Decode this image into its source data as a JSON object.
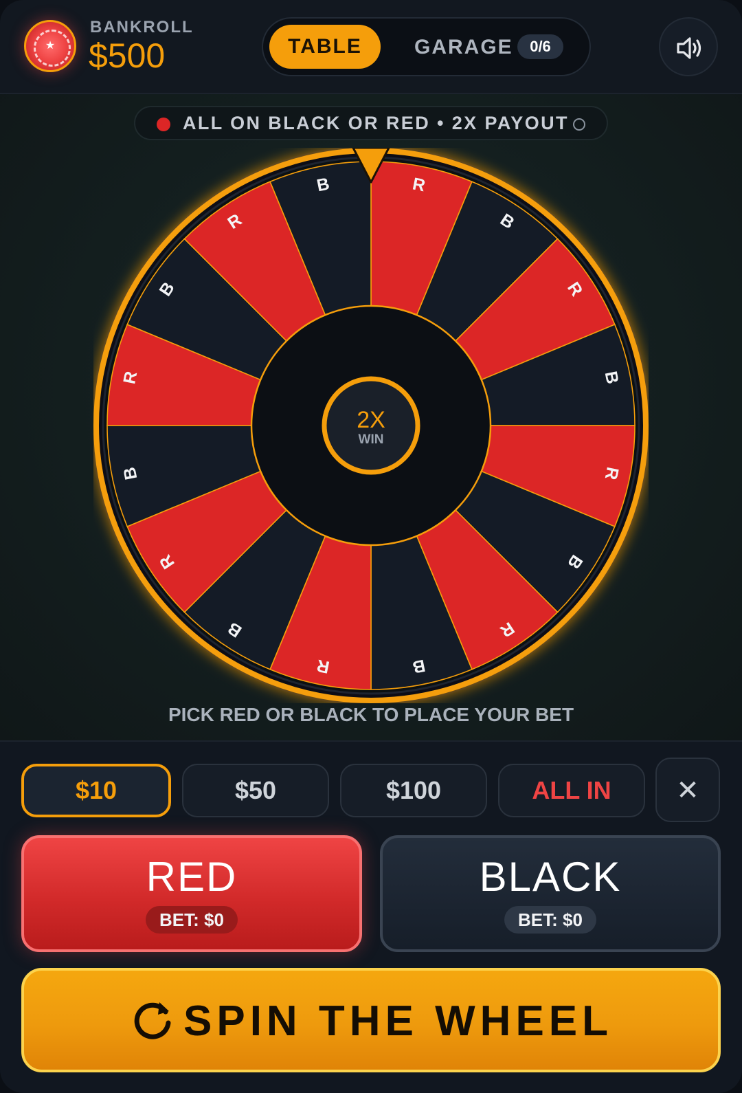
{
  "header": {
    "bankroll_label": "BANKROLL",
    "bankroll_value": "$500",
    "tabs": [
      {
        "label": "TABLE",
        "active": true
      },
      {
        "label": "GARAGE",
        "badge": "0/6",
        "active": false
      }
    ],
    "sound_icon": "speaker-icon"
  },
  "banner": {
    "text": "ALL ON BLACK OR RED • 2X PAYOUT"
  },
  "wheel": {
    "segments": [
      "R",
      "B",
      "R",
      "B",
      "R",
      "B",
      "R",
      "B",
      "R",
      "B",
      "R",
      "B",
      "R",
      "B",
      "R",
      "B"
    ],
    "center_multiplier": "2X",
    "center_label": "WIN",
    "colors": {
      "red": "#dc2626",
      "black": "#141b26",
      "rim": "#f59e0b",
      "hub": "#0c0f14"
    }
  },
  "prompt": "PICK RED OR BLACK TO PLACE YOUR BET",
  "amounts": [
    {
      "label": "$10",
      "selected": true
    },
    {
      "label": "$50",
      "selected": false
    },
    {
      "label": "$100",
      "selected": false
    },
    {
      "label": "ALL IN",
      "selected": false
    }
  ],
  "clear_label": "✕",
  "bets": {
    "red": {
      "label": "RED",
      "amount": "BET: $0"
    },
    "black": {
      "label": "BLACK",
      "amount": "BET: $0"
    }
  },
  "spin_label": "SPIN THE WHEEL",
  "accent": "#f59e0b"
}
